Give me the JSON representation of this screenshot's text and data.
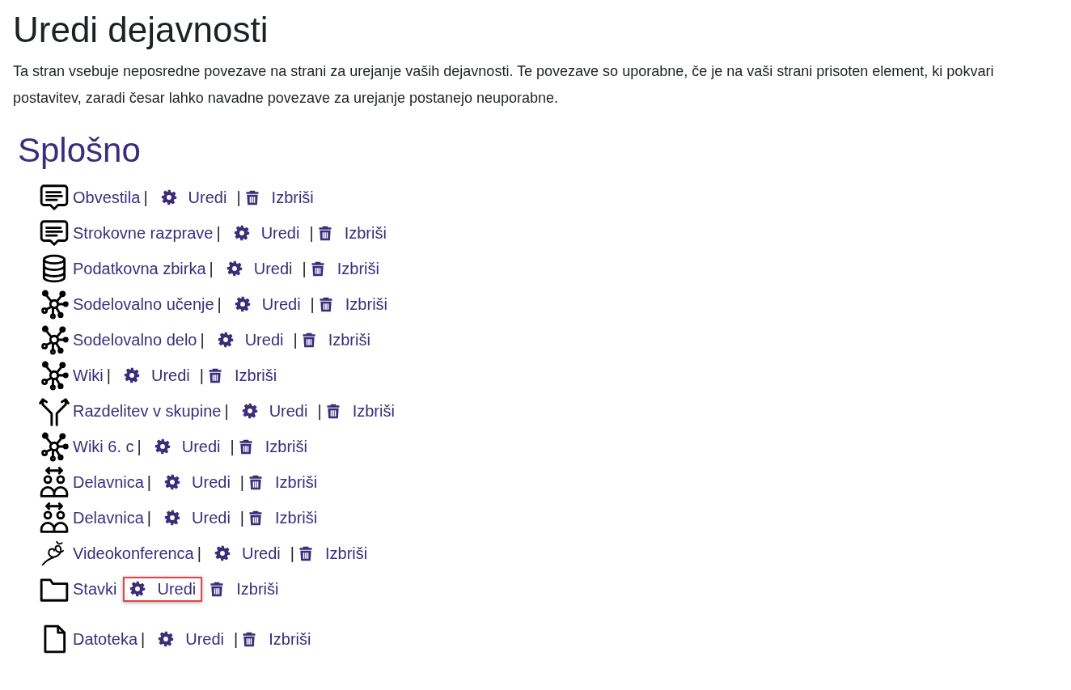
{
  "title": "Uredi dejavnosti",
  "description": "Ta stran vsebuje neposredne povezave na strani za urejanje vaših dejavnosti. Te povezave so uporabne, če je na vaši strani prisoten element, ki pokvari postavitev, zaradi česar lahko navadne povezave za urejanje postanejo neuporabne.",
  "section": {
    "heading": "Splošno",
    "items": [
      {
        "kind": "forum",
        "name": "Obvestila",
        "sep1": "|",
        "edit": "Uredi",
        "sep2": "|",
        "delete": "Izbriši",
        "highlighted": false
      },
      {
        "kind": "forum",
        "name": "Strokovne razprave",
        "sep1": "|",
        "edit": "Uredi",
        "sep2": "|",
        "delete": "Izbriši",
        "highlighted": false
      },
      {
        "kind": "database",
        "name": "Podatkovna zbirka",
        "sep1": "|",
        "edit": "Uredi",
        "sep2": "|",
        "delete": "Izbriši",
        "highlighted": false
      },
      {
        "kind": "network",
        "name": "Sodelovalno učenje",
        "sep1": "|",
        "edit": "Uredi",
        "sep2": "|",
        "delete": "Izbriši",
        "highlighted": false
      },
      {
        "kind": "network",
        "name": "Sodelovalno delo",
        "sep1": "|",
        "edit": "Uredi",
        "sep2": "|",
        "delete": "Izbriši",
        "highlighted": false
      },
      {
        "kind": "network",
        "name": "Wiki",
        "sep1": "|",
        "edit": "Uredi",
        "sep2": "|",
        "delete": "Izbriši",
        "highlighted": false
      },
      {
        "kind": "fork",
        "name": "Razdelitev v skupine",
        "sep1": "|",
        "edit": "Uredi",
        "sep2": "|",
        "delete": "Izbriši",
        "highlighted": false
      },
      {
        "kind": "network",
        "name": "Wiki 6. c",
        "sep1": "|",
        "edit": "Uredi",
        "sep2": "|",
        "delete": "Izbriši",
        "highlighted": false
      },
      {
        "kind": "workshop",
        "name": "Delavnica",
        "sep1": "|",
        "edit": "Uredi",
        "sep2": "|",
        "delete": "Izbriši",
        "highlighted": false
      },
      {
        "kind": "workshop",
        "name": "Delavnica",
        "sep1": "|",
        "edit": "Uredi",
        "sep2": "|",
        "delete": "Izbriši",
        "highlighted": false
      },
      {
        "kind": "video",
        "name": "Videokonferenca",
        "sep1": "|",
        "edit": "Uredi",
        "sep2": "|",
        "delete": "Izbriši",
        "highlighted": false
      },
      {
        "kind": "folder",
        "name": "Stavki",
        "edit": "Uredi",
        "delete": "Izbriši",
        "highlighted": true
      },
      {
        "kind": "file",
        "name": "Datoteka",
        "sep1": "|",
        "edit": "Uredi",
        "sep2": "|",
        "delete": "Izbriši",
        "highlighted": false
      }
    ]
  }
}
